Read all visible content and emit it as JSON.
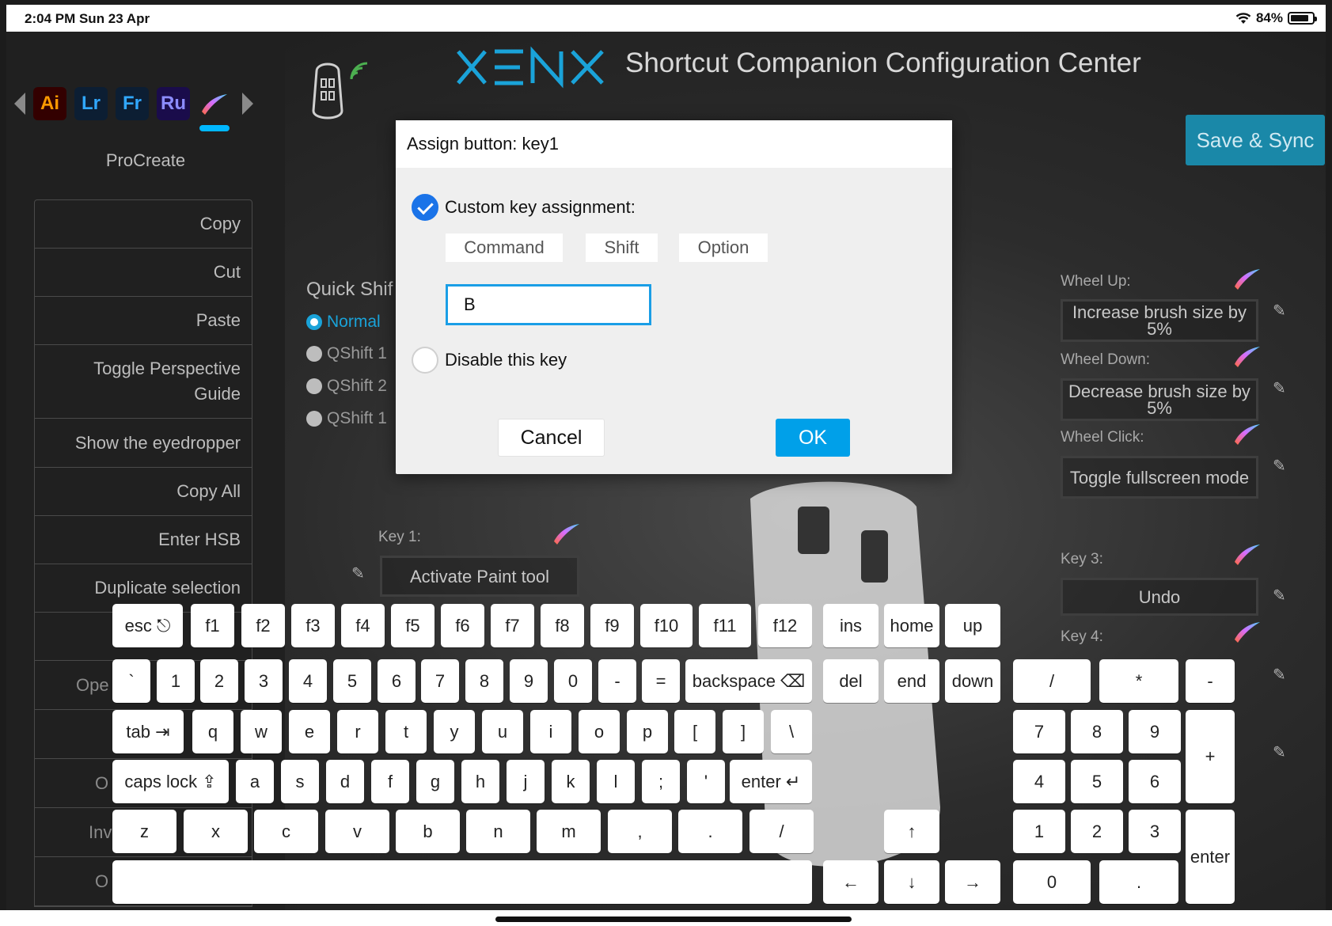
{
  "status_bar": {
    "time": "2:04 PM   Sun 23 Apr",
    "battery": "84%",
    "battery_level": 0.84,
    "icons": [
      "wifi-icon",
      "battery-icon"
    ]
  },
  "app_switcher": {
    "apps": [
      "Ai",
      "Lr",
      "Fr",
      "Ru"
    ],
    "selected_app_icon": "procreate-brush-icon",
    "app_name": "ProCreate"
  },
  "shortcut_list": [
    "Copy",
    "Cut",
    "Paste",
    "Toggle Perspective Guide",
    "Show the eyedropper",
    "Copy All",
    "Enter HSB",
    "Duplicate selection",
    "",
    "Ope",
    "",
    "O",
    "Inv",
    "O"
  ],
  "header": {
    "brand": "XENX",
    "title": "Shortcut Companion Configuration Center",
    "save_label": "Save & Sync",
    "accent": "#1aa3d9"
  },
  "quick_shift": {
    "title": "Quick Shif",
    "options": [
      "Normal",
      "QShift 1",
      "QShift 2",
      "QShift 1"
    ],
    "selected_index": 0
  },
  "device_keys": {
    "key1_label": "Key 1:",
    "key1_value": "Activate Paint tool",
    "wheel_up_label": "Wheel Up:",
    "wheel_up_value": "Increase brush size by 5%",
    "wheel_down_label": "Wheel Down:",
    "wheel_down_value": "Decrease brush size by 5%",
    "wheel_click_label": "Wheel Click:",
    "wheel_click_value": "Toggle fullscreen mode",
    "key3_label": "Key 3:",
    "key3_value": "Undo",
    "key4_label": "Key 4:"
  },
  "dialog": {
    "title": "Assign button: key1",
    "custom_label": "Custom key assignment:",
    "custom_checked": true,
    "modifiers": [
      "Command",
      "Shift",
      "Option"
    ],
    "key_value": "B",
    "disable_label": "Disable this key",
    "disable_checked": false,
    "cancel_label": "Cancel",
    "ok_label": "OK"
  },
  "keyboard": {
    "row_fn": [
      "esc ⎋",
      "f1",
      "f2",
      "f3",
      "f4",
      "f5",
      "f6",
      "f7",
      "f8",
      "f9",
      "f10",
      "f11",
      "f12"
    ],
    "nav_top": [
      "ins",
      "home",
      "up"
    ],
    "row_num": [
      "`",
      "1",
      "2",
      "3",
      "4",
      "5",
      "6",
      "7",
      "8",
      "9",
      "0",
      "-",
      "=",
      "backspace ⌫"
    ],
    "nav_mid": [
      "del",
      "end",
      "down"
    ],
    "row_q": [
      "tab ⇥",
      "q",
      "w",
      "e",
      "r",
      "t",
      "y",
      "u",
      "i",
      "o",
      "p",
      "[",
      "]",
      "\\"
    ],
    "row_a": [
      "caps lock ⇪",
      "a",
      "s",
      "d",
      "f",
      "g",
      "h",
      "j",
      "k",
      "l",
      ";",
      "'",
      "enter ↵"
    ],
    "row_z": [
      "z",
      "x",
      "c",
      "v",
      "b",
      "n",
      "m",
      ",",
      ".",
      "/"
    ],
    "arrows": [
      "↑",
      "←",
      "↓",
      "→"
    ],
    "numpad": [
      "/",
      "*",
      "-",
      "7",
      "8",
      "9",
      "+",
      "4",
      "5",
      "6",
      "1",
      "2",
      "3",
      "enter",
      "0",
      "."
    ],
    "space": ""
  }
}
